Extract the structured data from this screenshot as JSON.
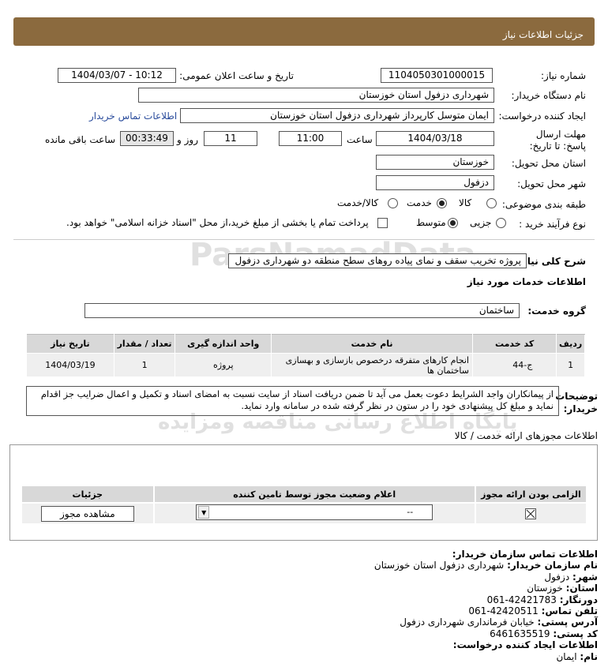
{
  "header": {
    "title": "جزئیات اطلاعات نیاز"
  },
  "form": {
    "need_number_label": "شماره نیاز:",
    "need_number": "1104050301000015",
    "announce_label": "تاریخ و ساعت اعلان عمومی:",
    "announce_value": "1404/03/07 - 10:12",
    "buyer_label": "نام دستگاه خریدار:",
    "buyer_value": "شهرداری دزفول استان خوزستان",
    "creator_label": "ایجاد کننده درخواست:",
    "creator_value": "ایمان متوسل کارپرداز شهرداری دزفول استان خوزستان",
    "contact_link": "اطلاعات تماس خریدار",
    "deadline_label": "مهلت ارسال پاسخ: تا تاریخ:",
    "deadline_date": "1404/03/18",
    "time_label": "ساعت",
    "deadline_time": "11:00",
    "days_value": "11",
    "days_label": "روز و",
    "remaining_value": "00:33:49",
    "remaining_label": "ساعت باقی مانده",
    "province_label": "استان محل تحویل:",
    "province_value": "خوزستان",
    "city_label": "شهر محل تحویل:",
    "city_value": "دزفول",
    "category_label": "طبقه بندی موضوعی:",
    "category_options": [
      "کالا",
      "خدمت",
      "کالا/خدمت"
    ],
    "category_selected": "خدمت",
    "process_label": "نوع فرآیند خرید :",
    "process_options": [
      "جزیی",
      "متوسط"
    ],
    "process_selected": "متوسط",
    "payment_note": "پرداخت تمام یا بخشی از مبلغ خرید،از محل \"اسناد خزانه اسلامی\" خواهد بود."
  },
  "summary": {
    "label": "شرح کلی نیاز:",
    "value": "پروژه تخریب سقف و نمای پیاده روهای سطح منطقه دو شهرداری دزفول"
  },
  "services": {
    "section_title": "اطلاعات خدمات مورد نیاز",
    "group_label": "گروه خدمت:",
    "group_value": "ساختمان",
    "columns": [
      "ردیف",
      "کد خدمت",
      "نام خدمت",
      "واحد اندازه گیری",
      "تعداد / مقدار",
      "تاریخ نیاز"
    ],
    "rows": [
      {
        "row": "1",
        "code": "ج-44",
        "name": "انجام کارهای متفرقه درخصوص بازسازی و بهسازی ساختمان ها",
        "unit": "پروژه",
        "qty": "1",
        "date": "1404/03/19"
      }
    ]
  },
  "notes": {
    "label": "توضیحات خریدار:",
    "text": "از پیمانکاران واجد الشرایط دعوت بعمل می آید تا ضمن دریافت اسناد از سایت نسبت به امضای اسناد و تکمیل و اعمال ضرایب جز اقدام نماید و مبلغ کل پیشنهادی خود را در ستون در نظر گرفته شده در سامانه وارد نماید."
  },
  "licenses": {
    "title": "اطلاعات مجوزهای ارائه خدمت / کالا",
    "columns": [
      "الزامی بودن ارائه مجوز",
      "اعلام وضعیت مجوز توسط تامین کننده",
      "جزئیات"
    ],
    "select_value": "--",
    "view_button": "مشاهده مجوز"
  },
  "contact": {
    "title": "اطلاعات تماس سازمان خریدار:",
    "org_label": "نام سازمان خریدار:",
    "org_value": "شهرداری دزفول استان خوزستان",
    "city_label": "شهر:",
    "city_value": "دزفول",
    "province_label": "استان:",
    "province_value": "خوزستان",
    "fax_label": "دورنگار:",
    "fax_value": "42421783-061",
    "phone_label": "تلفن تماس:",
    "phone_value": "42420511-061",
    "address_label": "آدرس پستی:",
    "address_value": "خیابان فرمانداری شهرداری دزفول",
    "postal_label": "کد پستی:",
    "postal_value": "6461635519",
    "creator_title": "اطلاعات ایجاد کننده درخواست:",
    "name_label": "نام:",
    "name_value": "ایمان"
  },
  "watermark": {
    "brand": "ParsNamadData",
    "line1": "پایگاه اطلاع رسانی مناقصه ومزایده",
    "phone": "۰۲۱-۸۸۳۴۹۶۷۰-۵"
  }
}
